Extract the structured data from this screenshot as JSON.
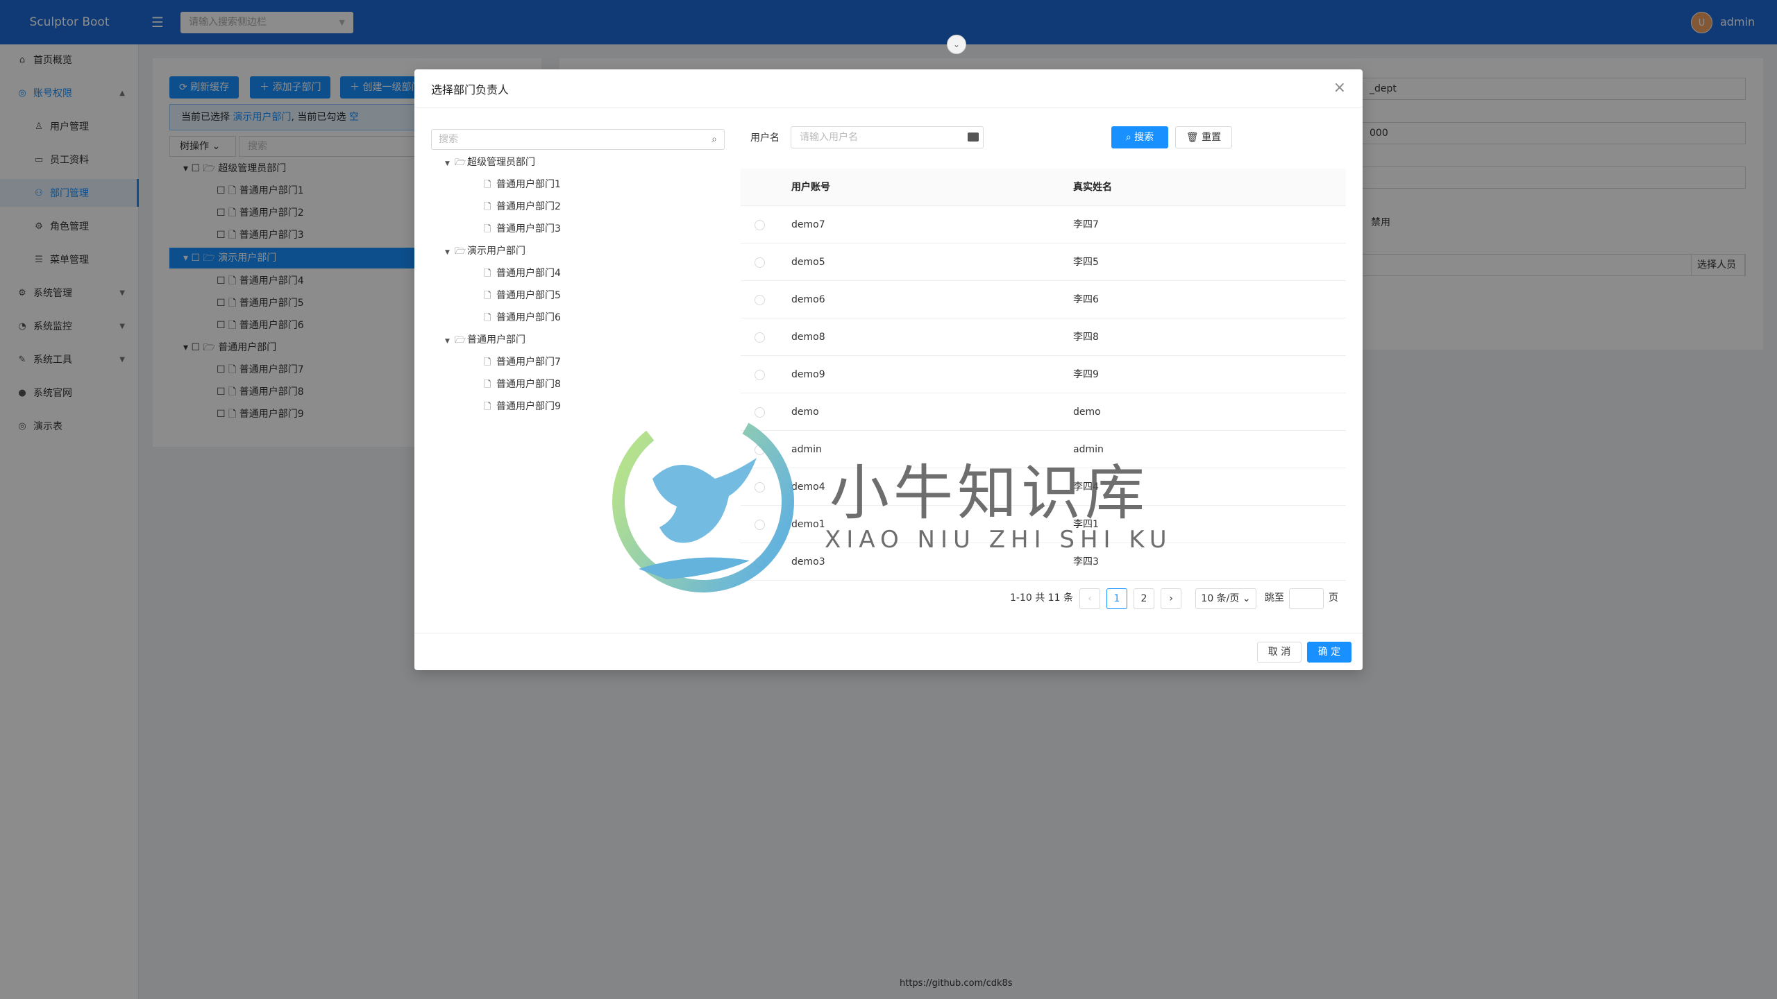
{
  "app": {
    "name": "Sculptor Boot",
    "search_placeholder": "请输入搜索侧边栏",
    "user": "admin",
    "avatar_letter": "U"
  },
  "sidebar": {
    "items": [
      {
        "label": "首页概览",
        "icon": "home-icon"
      },
      {
        "label": "账号权限",
        "icon": "safety-icon"
      },
      {
        "label": "用户管理",
        "icon": "user-icon"
      },
      {
        "label": "员工资料",
        "icon": "idcard-icon"
      },
      {
        "label": "部门管理",
        "icon": "team-icon"
      },
      {
        "label": "角色管理",
        "icon": "role-icon"
      },
      {
        "label": "菜单管理",
        "icon": "menu-icon"
      },
      {
        "label": "系统管理",
        "icon": "setting-icon"
      },
      {
        "label": "系统监控",
        "icon": "monitor-icon"
      },
      {
        "label": "系统工具",
        "icon": "tool-icon"
      },
      {
        "label": "系统官网",
        "icon": "github-icon"
      },
      {
        "label": "演示表",
        "icon": "table-icon"
      }
    ]
  },
  "bg": {
    "refresh_btn": "刷新缓存",
    "add_child_btn": "添加子部门",
    "create_root_btn": "创建一级部门",
    "info_prefix": "当前已选择",
    "info_selected": "演示用户部门",
    "info_mid": ", 当前已勾选",
    "info_checked": "空",
    "tree_ops": "树操作",
    "tree_search": "搜索",
    "tree": [
      "超级管理员部门",
      "普通用户部门1",
      "普通用户部门2",
      "普通用户部门3",
      "演示用户部门",
      "普通用户部门4",
      "普通用户部门5",
      "普通用户部门6",
      "普通用户部门",
      "普通用户部门7",
      "普通用户部门8",
      "普通用户部门9"
    ],
    "right_val1": "_dept",
    "right_val2": "000",
    "right_disabled": "禁用",
    "right_pick_btn": "选择人员"
  },
  "modal": {
    "title": "选择部门负责人",
    "tree_search_placeholder": "搜索",
    "tree": [
      {
        "label": "超级管理员部门",
        "children": [
          "普通用户部门1",
          "普通用户部门2",
          "普通用户部门3"
        ]
      },
      {
        "label": "演示用户部门",
        "children": [
          "普通用户部门4",
          "普通用户部门5",
          "普通用户部门6"
        ]
      },
      {
        "label": "普通用户部门",
        "children": [
          "普通用户部门7",
          "普通用户部门8",
          "普通用户部门9"
        ]
      }
    ],
    "filter_label": "用户名",
    "filter_placeholder": "请输入用户名",
    "search_btn": "搜索",
    "reset_btn": "重置",
    "columns": [
      "用户账号",
      "真实姓名"
    ],
    "rows": [
      [
        "demo7",
        "李四7"
      ],
      [
        "demo5",
        "李四5"
      ],
      [
        "demo6",
        "李四6"
      ],
      [
        "demo8",
        "李四8"
      ],
      [
        "demo9",
        "李四9"
      ],
      [
        "demo",
        "demo"
      ],
      [
        "admin",
        "admin"
      ],
      [
        "demo4",
        "李四4"
      ],
      [
        "demo1",
        "李四1"
      ],
      [
        "demo3",
        "李四3"
      ]
    ],
    "pagination": {
      "summary": "1-10 共 11 条",
      "pages": [
        "1",
        "2"
      ],
      "page_size": "10 条/页",
      "jump_label": "跳至",
      "page_unit": "页"
    },
    "cancel_btn": "取 消",
    "ok_btn": "确 定"
  },
  "watermark": {
    "cn": "小牛知识库",
    "en": "XIAO NIU ZHI SHI KU"
  },
  "footer": "https://github.com/cdk8s"
}
